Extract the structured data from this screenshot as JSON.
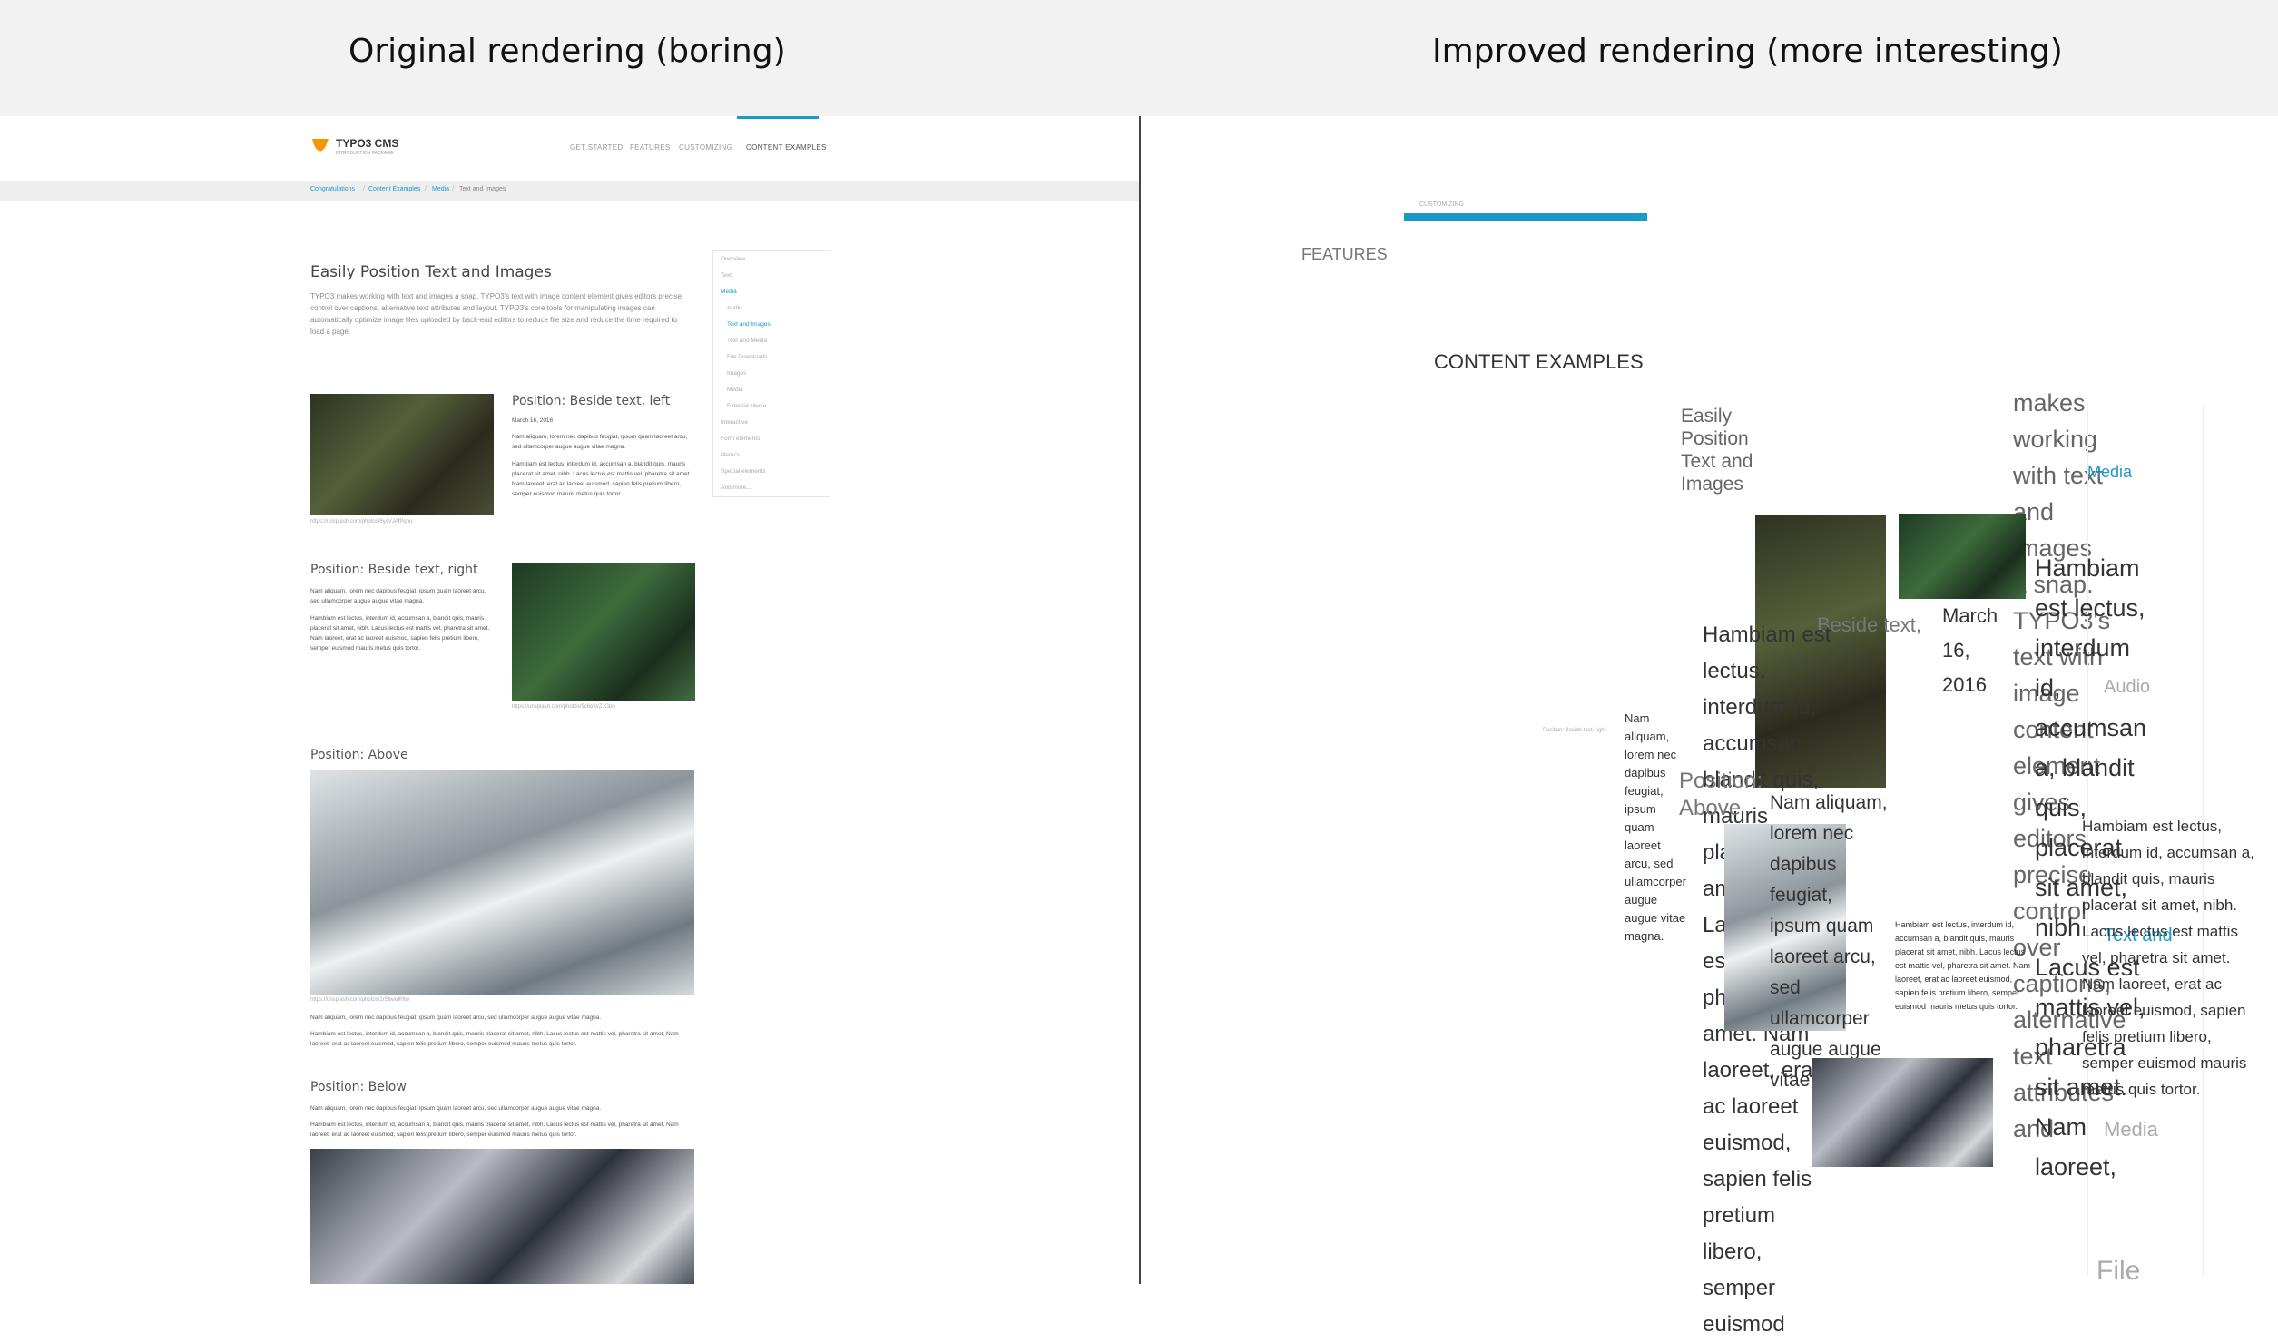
{
  "header": {
    "left_title": "Original rendering (boring)",
    "right_title": "Improved rendering (more interesting)"
  },
  "left": {
    "logo": {
      "name": "TYPO3 CMS",
      "tag": "INTRODUCTION PACKAGE"
    },
    "nav": [
      "GET STARTED",
      "FEATURES",
      "CUSTOMIZING",
      "CONTENT EXAMPLES"
    ],
    "breadcrumb": [
      "Congratulations",
      "Content Examples",
      "Media",
      "Text and Images"
    ],
    "title": "Easily Position Text and Images",
    "intro": "TYPO3 makes working with text and images a snap. TYPO3's text with image content element gives editors precise control over captions, alternative text attributes and layout. TYPO3's core tools for manipulating images can automatically optimize image files uploaded by back-end editors to reduce file size and reduce the time required to load a page.",
    "sidebar": [
      {
        "label": "Overview",
        "active": false,
        "sub": false
      },
      {
        "label": "Text",
        "active": false,
        "sub": false
      },
      {
        "label": "Media",
        "active": true,
        "sub": false
      },
      {
        "label": "Audio",
        "active": false,
        "sub": true
      },
      {
        "label": "Text and Images",
        "active": true,
        "sub": true
      },
      {
        "label": "Text and Media",
        "active": false,
        "sub": true
      },
      {
        "label": "File Downloads",
        "active": false,
        "sub": true
      },
      {
        "label": "Images",
        "active": false,
        "sub": true
      },
      {
        "label": "Media",
        "active": false,
        "sub": true
      },
      {
        "label": "External Media",
        "active": false,
        "sub": true
      },
      {
        "label": "Interactive",
        "active": false,
        "sub": false
      },
      {
        "label": "Form elements",
        "active": false,
        "sub": false
      },
      {
        "label": "Menu's",
        "active": false,
        "sub": false
      },
      {
        "label": "Special elements",
        "active": false,
        "sub": false
      },
      {
        "label": "And more...",
        "active": false,
        "sub": false
      }
    ],
    "sections": [
      {
        "title": "Position: Beside text, left",
        "date": "March 16, 2016",
        "p1": "Nam aliquam, lorem nec dapibus feugiat, ipsum quam laoreet arcu, sed ullamcorper augue augue vitae magna.",
        "p2": "Hambiam est lectus, interdum id, accumsan a, blandit quis, mauris placerat sit amet, nibh. Lacus lectus est mattis vel, pharetra sit amet. Nam laoreet, erat ac laoreet euismod, sapien felis pretium libero, semper euismod mauris metus quis tortor.",
        "caption": "https://unsplash.com/photos/6ysVJAfPqho"
      },
      {
        "title": "Position: Beside text, right",
        "p1": "Nam aliquam, lorem nec dapibus feugiat, ipsum quam laoreet arcu, sed ullamcorper augue augue vitae magna.",
        "p2": "Hambiam est lectus, interdum id, accumsan a, blandit quis, mauris placerat sit amet, nibh. Lacus lectus est mattis vel, pharetra sit amet. Nam laoreet, erat ac laoreet euismod, sapien felis pretium libero, semper euismod mauris metus quis tortor.",
        "caption": "https://unsplash.com/photos/9c6o3vZJGbo"
      },
      {
        "title": "Position: Above",
        "p1": "Nam aliquam, lorem nec dapibus feugiat, ipsum quam laoreet arcu, sed ullamcorper augue augue vitae magna.",
        "p2": "Hambiam est lectus, interdum id, accumsan a, blandit quis, mauris placerat sit amet, nibh. Lacus lectus est mattis vel, pharetra sit amet. Nam laoreet, erat ac laoreet euismod, sapien felis pretium libero, semper euismod mauris metus quis tortor.",
        "caption": "https://unsplash.com/photos/1rStwxdMtw"
      },
      {
        "title": "Position: Below",
        "p1": "Nam aliquam, lorem nec dapibus feugiat, ipsum quam laoreet arcu, sed ullamcorper augue augue vitae magna.",
        "p2": "Hambiam est lectus, interdum id, accumsan a, blandit quis, mauris placerat sit amet, nibh. Lacus lectus est mattis vel, pharetra sit amet. Nam laoreet, erat ac laoreet euismod, sapien felis pretium libero, semper euismod mauris metus quis tortor."
      }
    ]
  },
  "right": {
    "customizing": "CUSTOMIZING",
    "features": "FEATURES",
    "content_examples": "CONTENT EXAMPLES",
    "title_stack": "Easily Position Text and Images",
    "side_text": "makes working with text and images a snap. TYPO3's text with image content element gives editors precise control over captions, alternative text attributes and",
    "media": "Media",
    "audio": "Audio",
    "text_and_images": "Text and",
    "media2": "Media",
    "file": "File",
    "hambiam": "Hambiam est lectus, interdum id, accumsan a, blandit quis, placerat sit amet, nibh Lacus est mattis vel, pharetra sit amet. Nam laoreet,",
    "date": "March 16, 2016",
    "beside": "Beside text,",
    "nam_aliquam": "Nam aliquam, lorem nec dapibus feugiat, ipsum quam laoreet arcu, sed ullamcorper augue augue vitae magna.",
    "big_body": "Hambiam est lectus, interdum id, accumsan a, blandit quis, mauris placerat sit amet, nibh. Lacus lectus est mattis vel, pharetra sit amet. Nam laoreet, erat ac laoreet euismod, sapien felis pretium libero, semper euismod",
    "position_above": "Position: Above",
    "tiny_body": "Hambiam est lectus, interdum id, accumsan a, blandit quis, mauris placerat sit amet, nibh. Lacus lectus est mattis vel, pharetra sit amet. Nam laoreet, erat ac laoreet euismod, sapien felis pretium libero, semper euismod mauris metus quis tortor.",
    "right_small": "Hambiam est lectus, interdum id, accumsan a, blandit quis, mauris placerat sit amet, nibh. Lacus lectus est mattis vel, pharetra sit amet. Nam laoreet, erat ac laoreet euismod, sapien felis pretium libero, semper euismod mauris metus quis tortor.",
    "beside_right": "Position: Beside text, right"
  }
}
